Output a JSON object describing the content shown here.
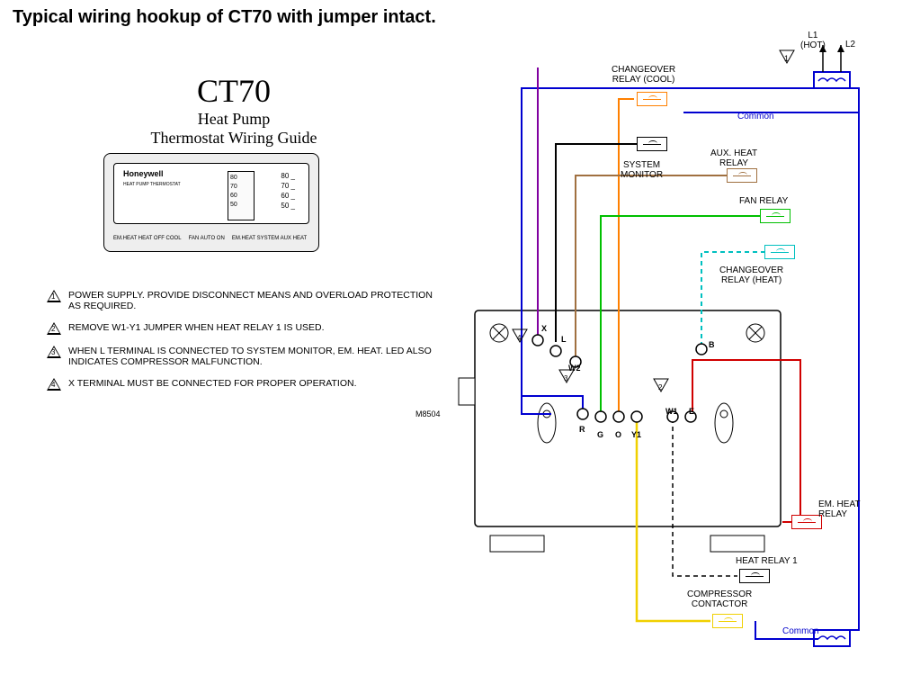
{
  "title": "Typical wiring hookup of CT70 with jumper intact.",
  "header": {
    "model": "CT70",
    "line1": "Heat Pump",
    "line2": "Thermostat Wiring Guide"
  },
  "thermostat": {
    "brand": "Honeywell",
    "subtext": "HEAT PUMP THERMOSTAT",
    "dial_values": "80\n70\n60\n50",
    "scale_values": "80 _\n70 _\n60 _\n50 _",
    "controls_left": "EM.HEAT  HEAT  OFF  COOL",
    "controls_mid": "FAN  AUTO ON",
    "controls_right": "EM.HEAT  SYSTEM  AUX HEAT"
  },
  "notes": [
    "POWER SUPPLY.  PROVIDE DISCONNECT MEANS AND OVERLOAD PROTECTION AS REQUIRED.",
    "REMOVE W1-Y1 JUMPER WHEN HEAT RELAY 1 IS USED.",
    "WHEN L TERMINAL IS CONNECTED TO SYSTEM MONITOR, EM. HEAT. LED ALSO INDICATES COMPRESSOR MALFUNCTION.",
    "X TERMINAL MUST BE CONNECTED FOR PROPER OPERATION."
  ],
  "drawing_id": "M8504",
  "labels": {
    "l1": "L1\n(HOT)",
    "l2": "L2",
    "changeover_cool": "CHANGEOVER\nRELAY (COOL)",
    "common": "Common",
    "common2": "Common",
    "system_monitor": "SYSTEM\nMONITOR",
    "aux_heat_relay": "AUX. HEAT\nRELAY",
    "fan_relay": "FAN RELAY",
    "changeover_heat": "CHANGEOVER\nRELAY (HEAT)",
    "em_heat_relay": "EM. HEAT\nRELAY",
    "heat_relay_1": "HEAT RELAY 1",
    "compressor_contactor": "COMPRESSOR\nCONTACTOR"
  },
  "terminals": {
    "X": "X",
    "L": "L",
    "W2": "W2",
    "R": "R",
    "G": "G",
    "O": "O",
    "Y1": "Y1",
    "W1": "W1",
    "E": "E",
    "B": "B"
  },
  "note_markers": {
    "n1": "1",
    "n2": "2",
    "n3": "3",
    "n4": "4"
  },
  "colors": {
    "blue": "#0000d0",
    "red": "#d00000",
    "green": "#00c000",
    "orange": "#ff8000",
    "yellow": "#f0d000",
    "purple": "#8000a0",
    "brown": "#805020",
    "cyan": "#00c0c0",
    "black": "#000000"
  }
}
